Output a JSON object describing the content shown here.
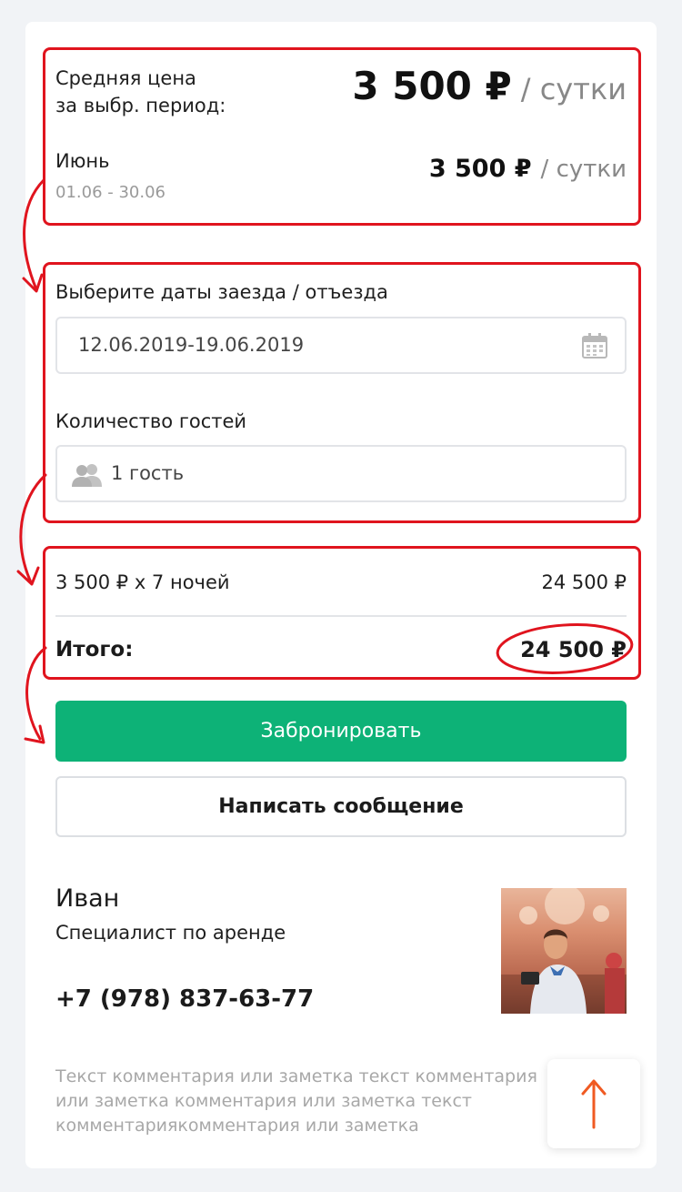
{
  "pricing": {
    "average_label_line1": "Средняя цена",
    "average_label_line2": "за выбр. период:",
    "average_price": "3 500 ₽",
    "average_unit": "/ сутки",
    "month_name": "Июнь",
    "month_range": "01.06 - 30.06",
    "month_price": "3 500 ₽",
    "month_unit": "/ сутки"
  },
  "booking_form": {
    "dates_label": "Выберите даты заезда / отъезда",
    "dates_value": "12.06.2019-19.06.2019",
    "guests_label": "Количество гостей",
    "guests_value": "1 гость"
  },
  "summary": {
    "nights_line": "3 500 ₽ x 7 ночей",
    "nights_amount": "24 500 ₽",
    "total_label": "Итого:",
    "total_amount": "24 500 ₽"
  },
  "actions": {
    "book_label": "Забронировать",
    "message_label": "Написать сообщение"
  },
  "contact": {
    "name": "Иван",
    "role": "Специалист по аренде",
    "phone": "+7 (978) 837-63-77"
  },
  "comment_text": "Текст комментария или заметка текст комментария или заметка комментария или заметка текст комментариякомментария или заметка",
  "colors": {
    "accent_green": "#0db277",
    "annotation_red": "#e0141e",
    "scroll_arrow": "#f05a22"
  },
  "icons": {
    "calendar": "calendar-icon",
    "guests": "users-icon",
    "scroll_top": "arrow-up-icon"
  }
}
